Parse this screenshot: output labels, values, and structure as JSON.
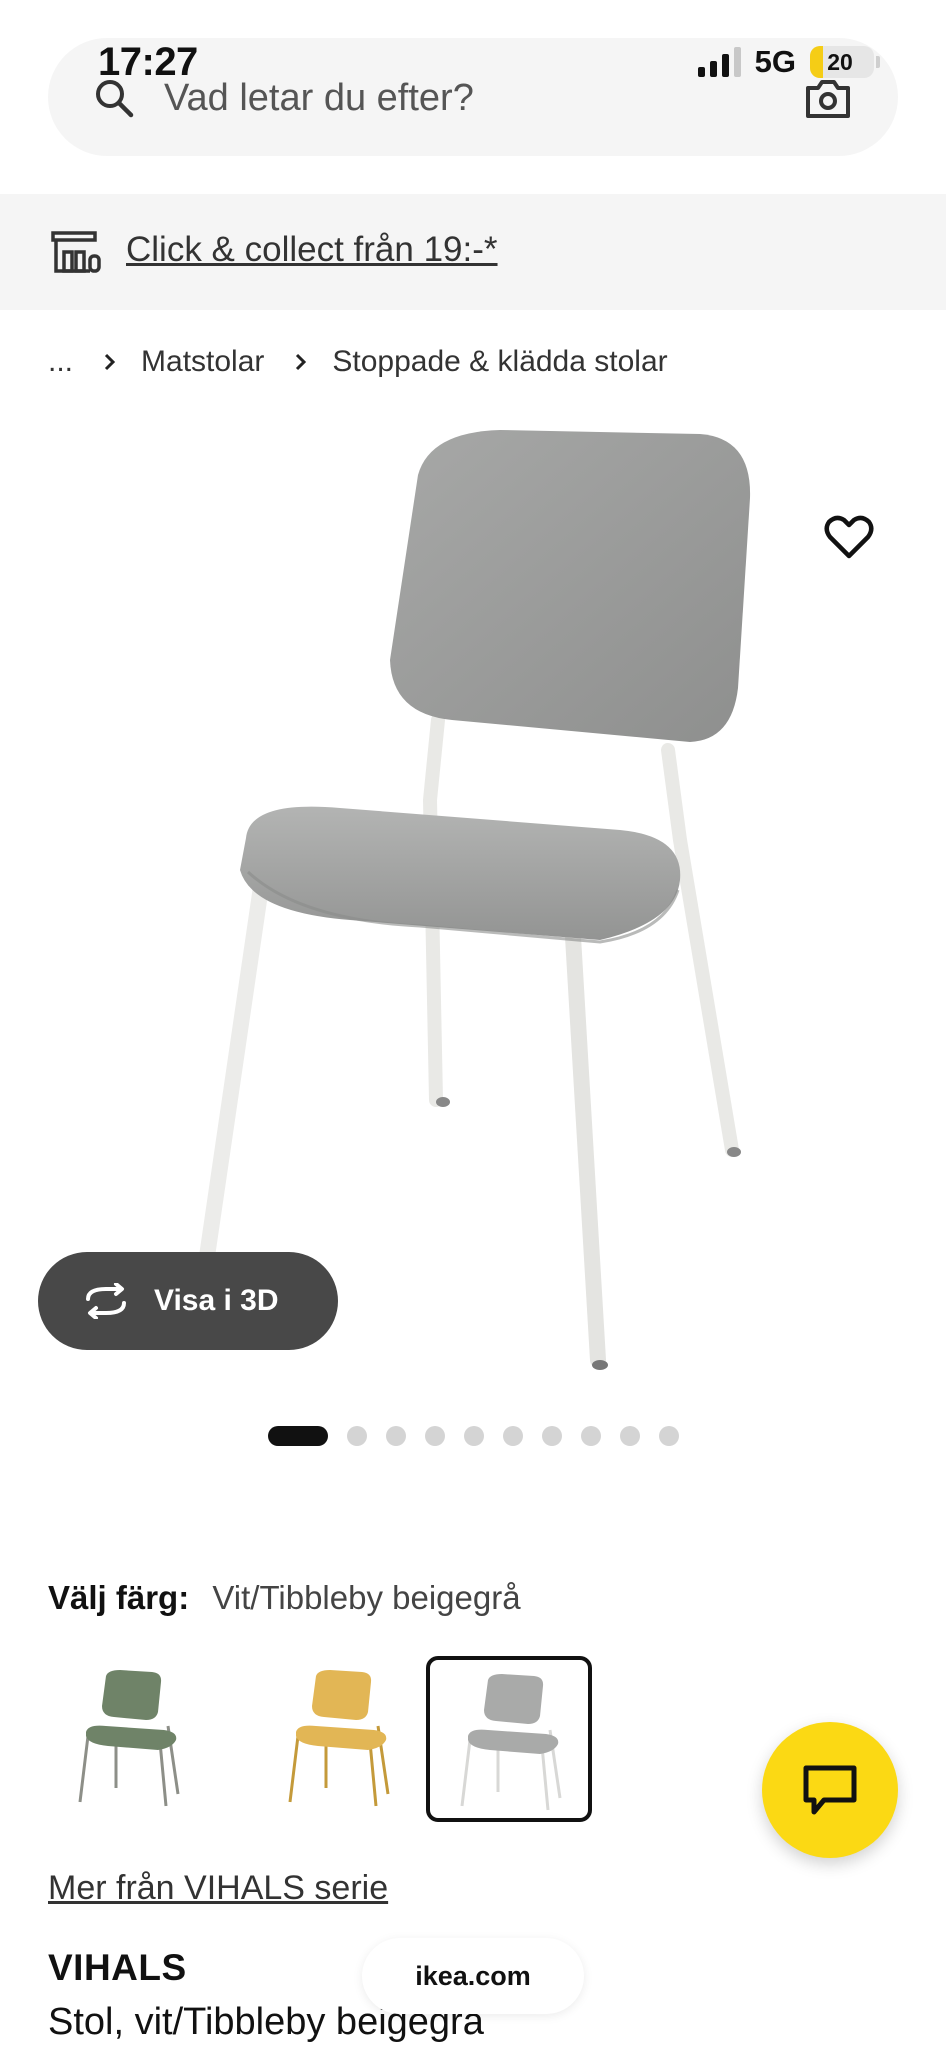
{
  "status_bar": {
    "time": "17:27",
    "network": "5G",
    "battery_level": "20",
    "battery_fraction": 0.2
  },
  "search": {
    "placeholder": "Vad letar du efter?"
  },
  "promo": {
    "label": "Click & collect från 19:-*"
  },
  "breadcrumb": {
    "ellipsis": "...",
    "items": [
      "Matstolar",
      "Stoppade & klädda stolar"
    ]
  },
  "gallery": {
    "view_3d_label": "Visa i 3D",
    "image_count": 10,
    "active_index": 0
  },
  "color_picker": {
    "label": "Välj färg:",
    "selected_value": "Vit/Tibbleby beigegrå",
    "swatches": [
      {
        "name": "green",
        "seat_color": "#6f8368",
        "leg_color": "#8d8f88"
      },
      {
        "name": "yellow",
        "seat_color": "#e2b655",
        "leg_color": "#c49a3a"
      },
      {
        "name": "grey",
        "seat_color": "#a9aaa9",
        "leg_color": "#f2f2f2",
        "selected": true
      }
    ]
  },
  "series_link": "Mer från VIHALS serie",
  "product": {
    "name": "VIHALS",
    "description": "Stol, vit/Tibbleby beigegrå"
  },
  "browser": {
    "url": "ikea.com"
  },
  "colors": {
    "accent_yellow": "#fbd914",
    "dark_button": "#484848",
    "panel_grey": "#f5f5f5"
  },
  "icons": [
    "search-icon",
    "camera-icon",
    "store-icon",
    "chevron-right-icon",
    "heart-icon",
    "rotate-3d-icon",
    "chat-icon"
  ]
}
